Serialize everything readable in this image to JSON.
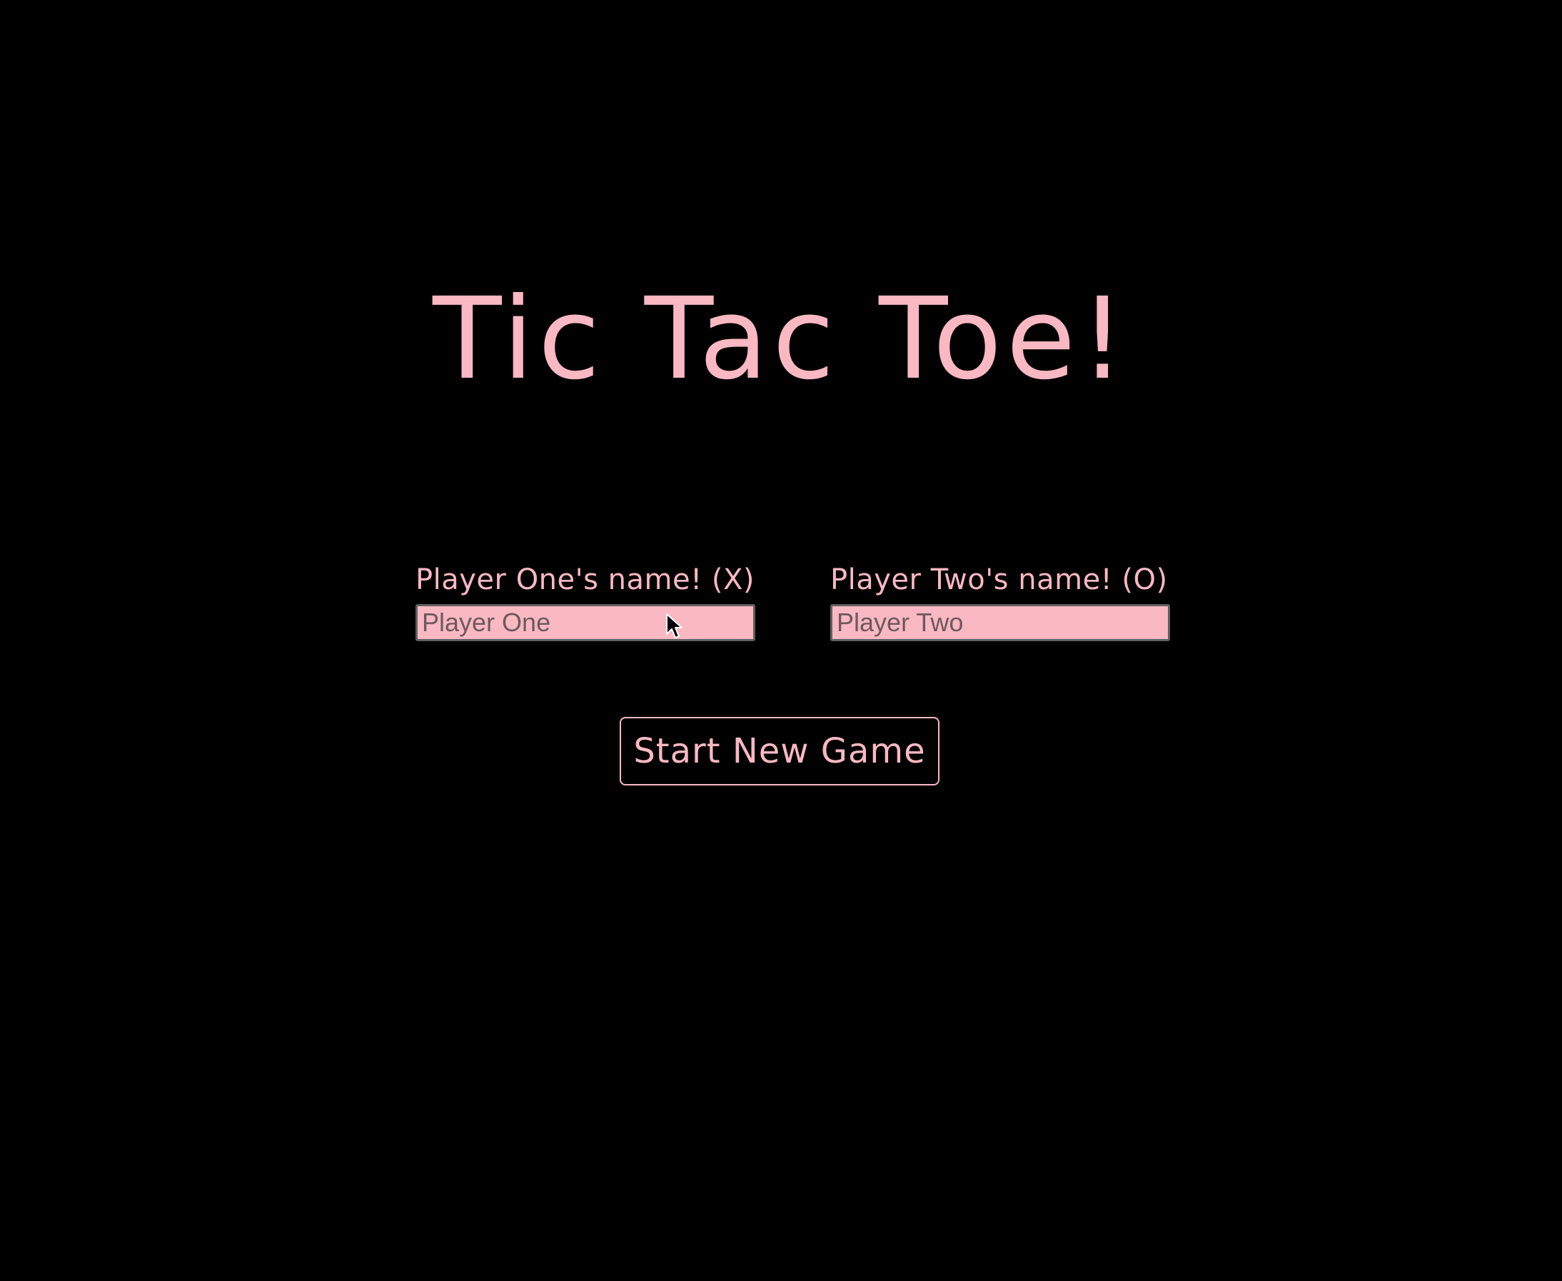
{
  "page": {
    "title": "Tic Tac Toe!"
  },
  "players": {
    "one": {
      "label": "Player One's name! (X)",
      "placeholder": "Player One",
      "value": ""
    },
    "two": {
      "label": "Player Two's name! (O)",
      "placeholder": "Player Two",
      "value": ""
    }
  },
  "actions": {
    "start_label": "Start New Game"
  },
  "theme": {
    "background": "#000000",
    "accent": "#f9b8c2",
    "input_border": "#5f5f5f"
  },
  "icons": {
    "cursor": "mouse-pointer-icon"
  }
}
